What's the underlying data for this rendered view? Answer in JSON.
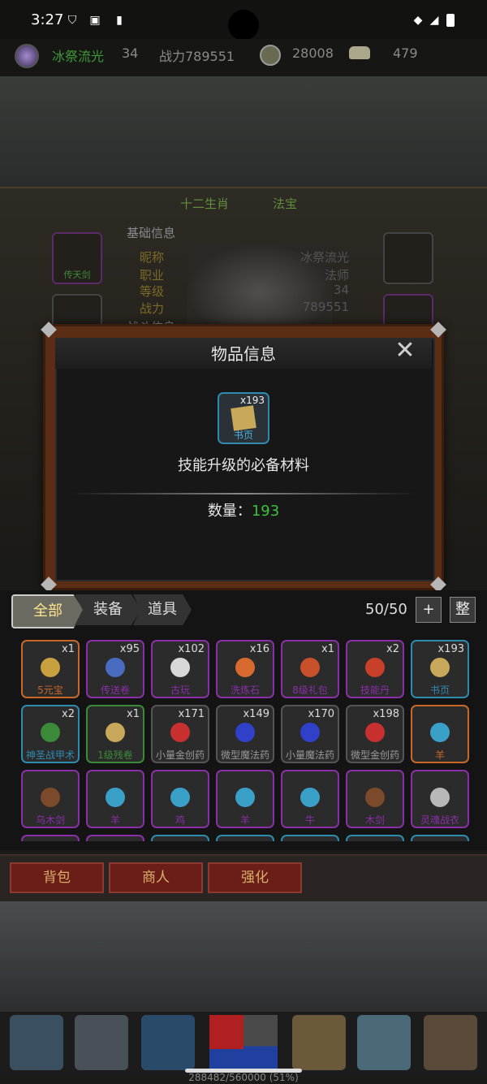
{
  "status_bar": {
    "time": "3:27"
  },
  "player": {
    "name": "冰祭流光",
    "level": "34",
    "power": "战力789551",
    "coins": "28008",
    "ingots": "479"
  },
  "char_panel": {
    "tabs": [
      "十二生肖",
      "法宝"
    ],
    "section": "基础信息",
    "info": [
      {
        "label": "昵称",
        "value": "冰祭流光"
      },
      {
        "label": "职业",
        "value": "法师"
      },
      {
        "label": "等级",
        "value": "34"
      },
      {
        "label": "战力",
        "value": "789551"
      }
    ],
    "battle_label": "战斗信息",
    "slot_label": "传天剑"
  },
  "dialog": {
    "title": "物品信息",
    "item_name": "书页",
    "item_count": "x193",
    "description": "技能升级的必备材料",
    "qty_label": "数量：",
    "qty_value": "193"
  },
  "bag": {
    "tabs": [
      "全部",
      "装备",
      "道具"
    ],
    "count": "50/50",
    "add": "+",
    "sort": "整",
    "rows": [
      [
        {
          "name": "5元宝",
          "count": "x1",
          "color": "#c7682a",
          "art": "#c8a040"
        },
        {
          "name": "传送卷",
          "count": "x95",
          "color": "#8a2fa8",
          "art": "#4a6cc0"
        },
        {
          "name": "古玩",
          "count": "x102",
          "color": "#8a2fa8",
          "art": "#d8d8d8"
        },
        {
          "name": "洗炼石",
          "count": "x16",
          "color": "#8a2fa8",
          "art": "#d86a30"
        },
        {
          "name": "8级礼包",
          "count": "x1",
          "color": "#8a2fa8",
          "art": "#c8502a"
        },
        {
          "name": "技能丹",
          "count": "x2",
          "color": "#8a2fa8",
          "art": "#c8402a"
        },
        {
          "name": "书页",
          "count": "x193",
          "color": "#2f8ab0",
          "art": "#c8a85a"
        }
      ],
      [
        {
          "name": "神圣战甲术",
          "count": "x2",
          "color": "#2f8ab0",
          "art": "#3a8a3a"
        },
        {
          "name": "1级残卷",
          "count": "x1",
          "color": "#3a8a3a",
          "art": "#c8a85a"
        },
        {
          "name": "小量金创药",
          "count": "x171",
          "color": "#555",
          "art": "#c83030"
        },
        {
          "name": "微型魔法药",
          "count": "x149",
          "color": "#555",
          "art": "#3040c8"
        },
        {
          "name": "小量魔法药",
          "count": "x170",
          "color": "#555",
          "art": "#3040c8"
        },
        {
          "name": "微型金创药",
          "count": "x198",
          "color": "#555",
          "art": "#c83030"
        },
        {
          "name": "羊",
          "count": "",
          "color": "#c7682a",
          "art": "#3aa0c8"
        }
      ],
      [
        {
          "name": "乌木剑",
          "count": "",
          "color": "#8a2fa8",
          "art": "#7a4a2a"
        },
        {
          "name": "羊",
          "count": "",
          "color": "#8a2fa8",
          "art": "#3aa0c8"
        },
        {
          "name": "鸡",
          "count": "",
          "color": "#8a2fa8",
          "art": "#3aa0c8"
        },
        {
          "name": "羊",
          "count": "",
          "color": "#8a2fa8",
          "art": "#3aa0c8"
        },
        {
          "name": "牛",
          "count": "",
          "color": "#8a2fa8",
          "art": "#3aa0c8"
        },
        {
          "name": "木剑",
          "count": "",
          "color": "#8a2fa8",
          "art": "#7a4a2a"
        },
        {
          "name": "灵魂战衣",
          "count": "",
          "color": "#8a2fa8",
          "art": "#b8b8b8"
        }
      ]
    ]
  },
  "menu": {
    "bag": "背包",
    "merchant": "商人",
    "enhance": "强化"
  },
  "exp": "288482/560000 (51%)"
}
